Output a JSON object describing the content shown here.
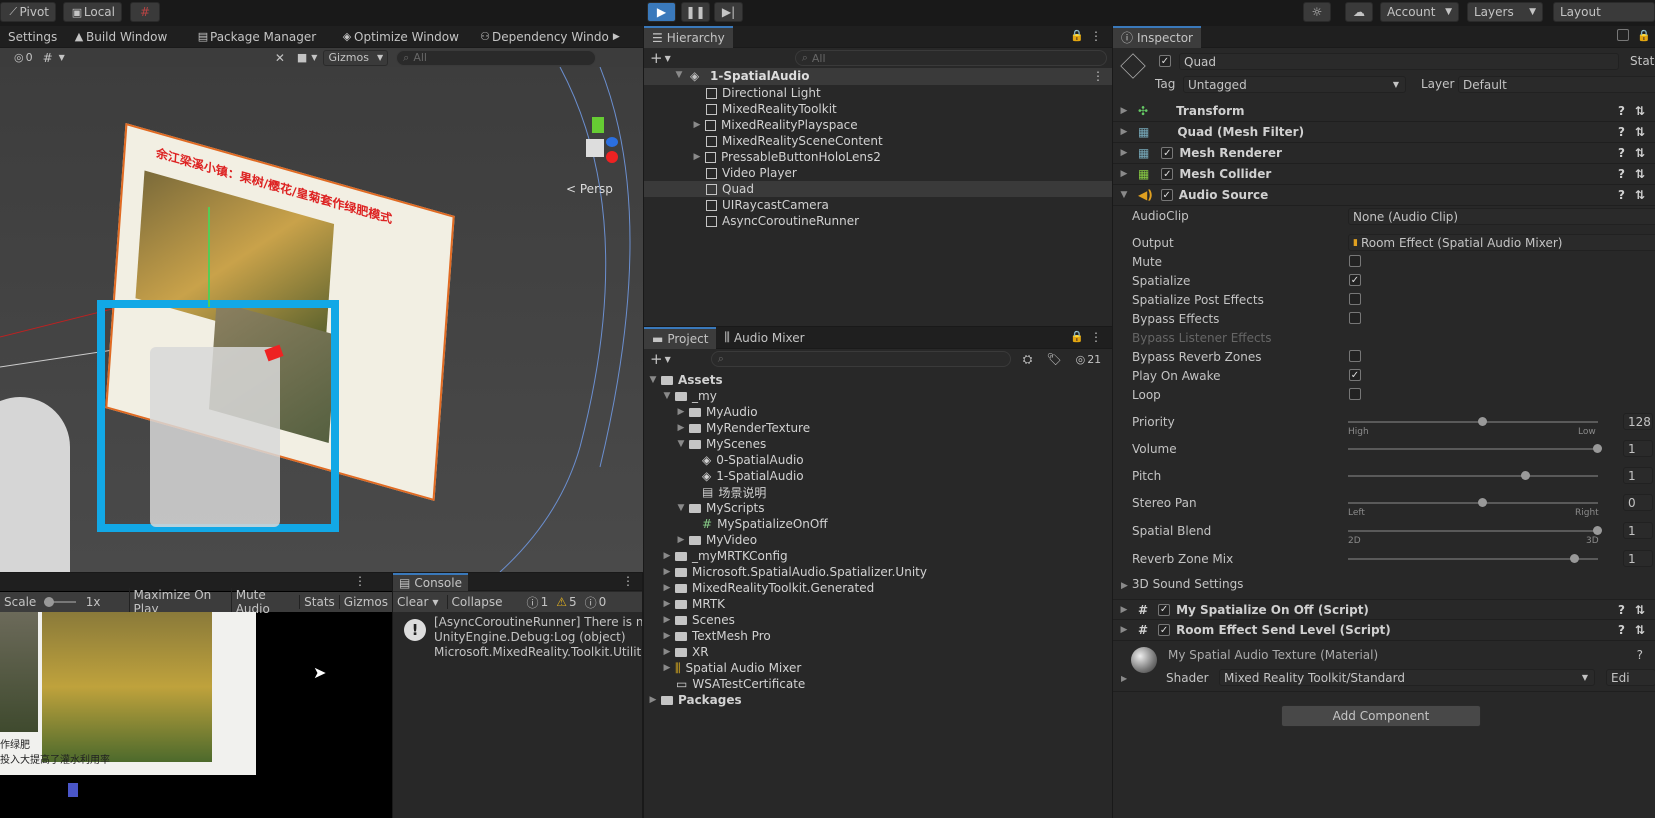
{
  "toolbar": {
    "pivot": "Pivot",
    "local": "Local",
    "account": "Account",
    "layers": "Layers",
    "layout": "Layout"
  },
  "scene": {
    "tabs": [
      "Settings",
      "Build Window",
      "Package Manager",
      "Optimize Window",
      "Dependency Windo"
    ],
    "gizmos": "Gizmos",
    "search_placeholder": "All",
    "hidden_count": "0",
    "persp": "Persp",
    "photo_title": "余江梁溪小镇：果树/樱花/皇菊套作绿肥模式"
  },
  "game": {
    "scale_label": "Scale",
    "scale_value": "1x",
    "maximize": "Maximize On Play",
    "mute": "Mute Audio",
    "stats": "Stats",
    "gizmos": "Gizmos",
    "caption1": "作绿肥",
    "caption2": "投入大提高了灌水利用率"
  },
  "console": {
    "tab": "Console",
    "clear": "Clear",
    "collapse": "Collapse",
    "count_info": "1",
    "count_warn": "5",
    "count_err": "0",
    "lines": [
      "[AsyncCoroutineRunner] There is no A",
      "UnityEngine.Debug:Log (object)",
      "Microsoft.MixedReality.Toolkit.Utilitie"
    ]
  },
  "hierarchy": {
    "tab": "Hierarchy",
    "search_placeholder": "All",
    "scene": "1-SpatialAudio",
    "items": [
      "Directional Light",
      "MixedRealityToolkit",
      "MixedRealityPlayspace",
      "MixedRealitySceneContent",
      "PressableButtonHoloLens2",
      "Video Player",
      "Quad",
      "UIRaycastCamera",
      "AsyncCoroutineRunner"
    ]
  },
  "project": {
    "tab": "Project",
    "tab2": "Audio Mixer",
    "hidden_count": "21",
    "items": [
      "Assets",
      "_my",
      "MyAudio",
      "MyRenderTexture",
      "MyScenes",
      "0-SpatialAudio",
      "1-SpatialAudio",
      "场景说明",
      "MyScripts",
      "MySpatializeOnOff",
      "MyVideo",
      "_myMRTKConfig",
      "Microsoft.SpatialAudio.Spatializer.Unity",
      "MixedRealityToolkit.Generated",
      "MRTK",
      "Scenes",
      "TextMesh Pro",
      "XR",
      "Spatial Audio Mixer",
      "WSATestCertificate",
      "Packages"
    ]
  },
  "inspector": {
    "tab": "Inspector",
    "name": "Quad",
    "static": "Stati",
    "tag_label": "Tag",
    "tag": "Untagged",
    "layer_label": "Layer",
    "layer": "Default",
    "components": [
      "Transform",
      "Quad (Mesh Filter)",
      "Mesh Renderer",
      "Mesh Collider",
      "Audio Source"
    ],
    "props": {
      "audioclip": "AudioClip",
      "audioclip_val": "None (Audio Clip)",
      "output": "Output",
      "output_val": "Room Effect (Spatial Audio Mixer)",
      "mute": "Mute",
      "spatialize": "Spatialize",
      "spatialize_post": "Spatialize Post Effects",
      "bypass_effects": "Bypass Effects",
      "bypass_listener": "Bypass Listener Effects",
      "bypass_reverb": "Bypass Reverb Zones",
      "play_on_awake": "Play On Awake",
      "loop": "Loop",
      "priority": "Priority",
      "priority_val": "128",
      "high": "High",
      "low": "Low",
      "volume": "Volume",
      "volume_val": "1",
      "pitch": "Pitch",
      "pitch_val": "1",
      "stereo_pan": "Stereo Pan",
      "stereo_pan_val": "0",
      "left": "Left",
      "right": "Right",
      "spatial_blend": "Spatial Blend",
      "spatial_blend_val": "1",
      "d2": "2D",
      "d3": "3D",
      "reverb_mix": "Reverb Zone Mix",
      "reverb_mix_val": "1",
      "sound3d": "3D Sound Settings"
    },
    "scripts": [
      "My Spatialize On Off (Script)",
      "Room Effect Send Level (Script)"
    ],
    "material": "My Spatial Audio Texture (Material)",
    "shader_label": "Shader",
    "shader": "Mixed Reality Toolkit/Standard",
    "edit": "Edi",
    "add_component": "Add Component"
  }
}
